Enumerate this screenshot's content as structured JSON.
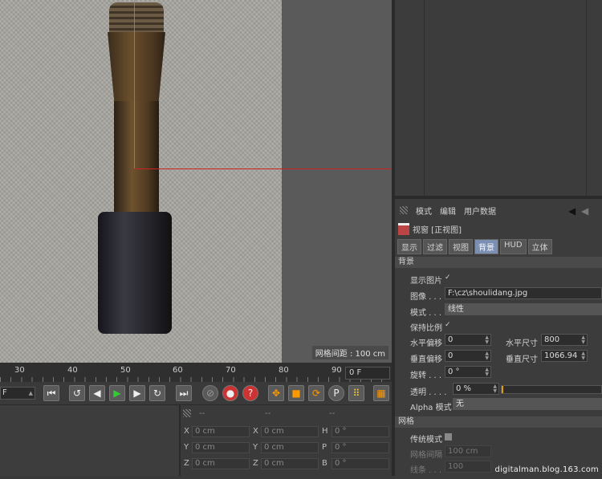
{
  "viewport": {
    "grid_label": "网格间距 : 100 cm"
  },
  "attr_manager": {
    "menu": [
      "模式",
      "编辑",
      "用户数据"
    ],
    "title": "视窗 [正视图]",
    "tabs": [
      "显示",
      "过滤",
      "视图",
      "背景",
      "HUD",
      "立体"
    ],
    "active_tab": "背景",
    "section_background": "背景",
    "show_image_label": "显示图片",
    "show_image_check": "✓",
    "image_label": "图像 . . .",
    "image_value": "F:\\cz\\shoulidang.jpg",
    "mode_label": "模式 . . .",
    "mode_value": "线性",
    "keep_ratio_label": "保持比例",
    "keep_ratio_check": "✓",
    "h_offset_label": "水平偏移",
    "h_offset_value": "0",
    "h_size_label": "水平尺寸",
    "h_size_value": "800",
    "v_offset_label": "垂直偏移",
    "v_offset_value": "0",
    "v_size_label": "垂直尺寸",
    "v_size_value": "1066.94",
    "rotate_label": "旋转 . . .",
    "rotate_value": "0 °",
    "transparency_label": "透明 . . . .",
    "transparency_value": "0 %",
    "alpha_label": "Alpha 模式",
    "alpha_value": "无",
    "section_grid": "网格",
    "legacy_mode_label": "传统模式",
    "grid_spacing_label": "网格间隔",
    "grid_spacing_value": "100 cm",
    "lines_label": "线条 . . .",
    "lines_value": "100"
  },
  "timeline": {
    "ticks": [
      "30",
      "40",
      "50",
      "60",
      "70",
      "80",
      "90"
    ],
    "current_frame": "0 F",
    "left_frame": "F"
  },
  "coords": {
    "dashes": [
      "--",
      "--",
      "--"
    ],
    "pos_labels": [
      "X",
      "Y",
      "Z"
    ],
    "pos_values": [
      "0 cm",
      "0 cm",
      "0 cm"
    ],
    "size_labels": [
      "X",
      "Y",
      "Z"
    ],
    "size_values": [
      "0 cm",
      "0 cm",
      "0 cm"
    ],
    "rot_labels": [
      "H",
      "P",
      "B"
    ],
    "rot_values": [
      "0 °",
      "0 °",
      "0 °"
    ]
  },
  "watermark": "digitalman.blog.163.com",
  "colors": {
    "accent_tab": "#7b8fb3",
    "axis_x": "#cc2222",
    "axis_y": "#33cc33"
  }
}
